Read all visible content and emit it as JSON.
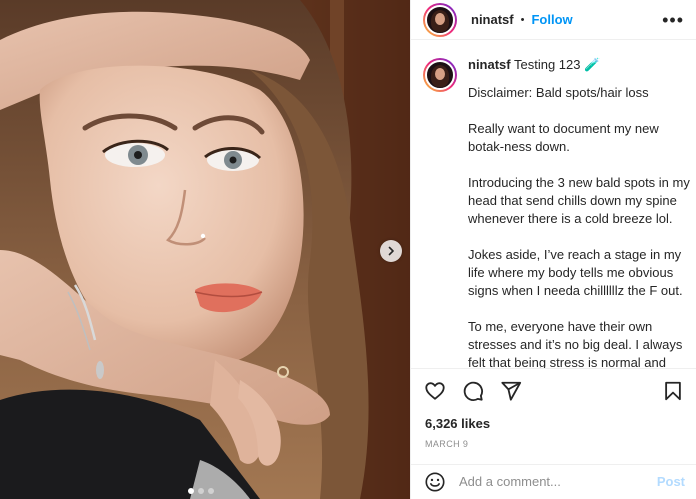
{
  "post": {
    "username": "ninatsf",
    "separator": "•",
    "follow_label": "Follow",
    "more_label": "•••",
    "caption": {
      "username": "ninatsf",
      "first_line": " Testing 123 🧪",
      "paragraphs": [
        "Disclaimer: Bald spots/hair loss",
        "Really want to document my new botak-ness down.",
        "Introducing the 3 new bald spots in my head that send chills down my spine whenever there is a cold breeze lol.",
        "Jokes aside, I’ve reach a stage in my life where my body tells me obvious signs when I needa chillllllz the F out.",
        "To me, everyone have their own stresses and it’s no big deal. I always felt that being stress is normal and there’s always an Anna Delvey in my head saying that it’s part and parcel"
      ]
    },
    "likes": "6,326 likes",
    "date": "MARCH 9",
    "comment": {
      "placeholder": "Add a comment...",
      "post_label": "Post"
    },
    "icons": {
      "like": "heart-icon",
      "comment": "comment-bubble-icon",
      "share": "paper-plane-icon",
      "save": "bookmark-icon",
      "emoji": "smiley-icon",
      "next": "chevron-right-icon"
    },
    "carousel": {
      "slides": 3,
      "active_index": 0
    },
    "colors": {
      "accent": "#0095f6",
      "post_disabled": "#b3dbff",
      "meta_text": "#8e8e8e"
    }
  }
}
